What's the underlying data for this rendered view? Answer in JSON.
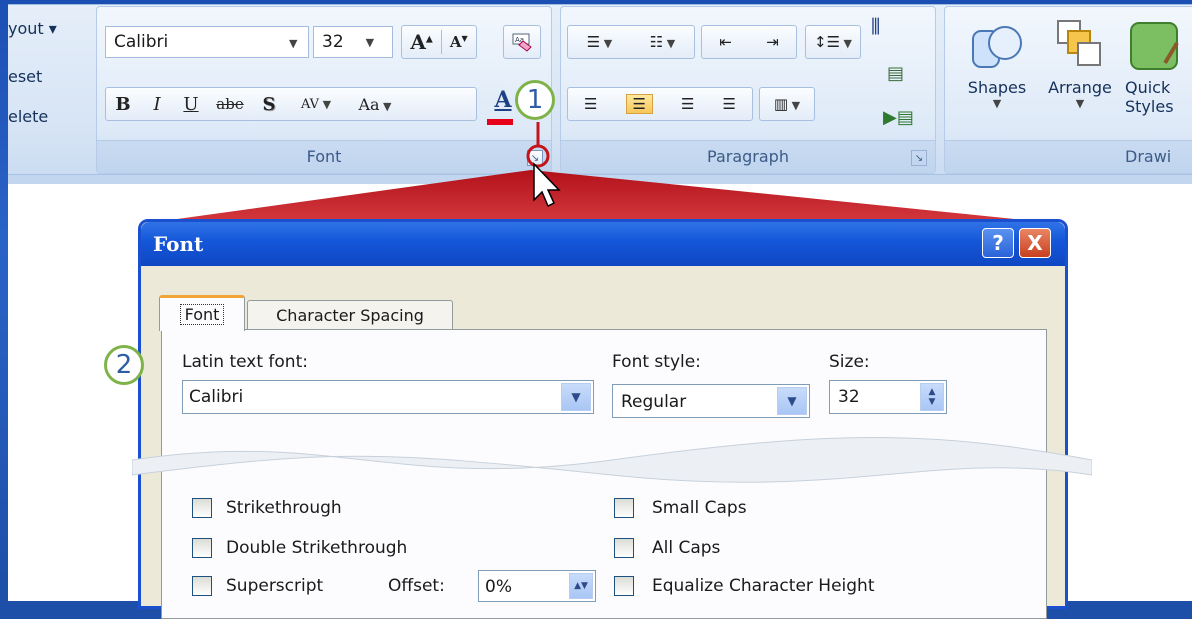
{
  "ribbon": {
    "left_items": [
      "yout ▾",
      "eset",
      "elete"
    ],
    "font_group": {
      "font_name": "Calibri",
      "font_size": "32",
      "label": "Font",
      "buttons": [
        "B",
        "I",
        "U",
        "abe",
        "S",
        "AV",
        "Aa",
        "A"
      ]
    },
    "paragraph_group": {
      "label": "Paragraph"
    },
    "drawing_group": {
      "label": "Drawi",
      "shapes_label": "Shapes",
      "arrange_label": "Arrange",
      "quick_styles_line1": "Quick",
      "quick_styles_line2": "Styles"
    }
  },
  "callouts": {
    "one": "1",
    "two": "2"
  },
  "dialog": {
    "title": "Font",
    "help_label": "?",
    "close_label": "X",
    "tabs": [
      "Font",
      "Character Spacing"
    ],
    "latin_font_label": "Latin text font:",
    "latin_font_value": "Calibri",
    "font_style_label": "Font style:",
    "font_style_value": "Regular",
    "size_label": "Size:",
    "size_value": "32",
    "effects": {
      "strikethrough": "Strikethrough",
      "double_strikethrough": "Double Strikethrough",
      "superscript": "Superscript",
      "offset_label": "Offset:",
      "offset_value": "0%",
      "small_caps": "Small Caps",
      "all_caps": "All Caps",
      "equalize": "Equalize Character Height"
    }
  },
  "colors": {
    "accent_red": "#c4141b",
    "title_blue": "#1456d9",
    "badge_green": "#7fb34a"
  }
}
